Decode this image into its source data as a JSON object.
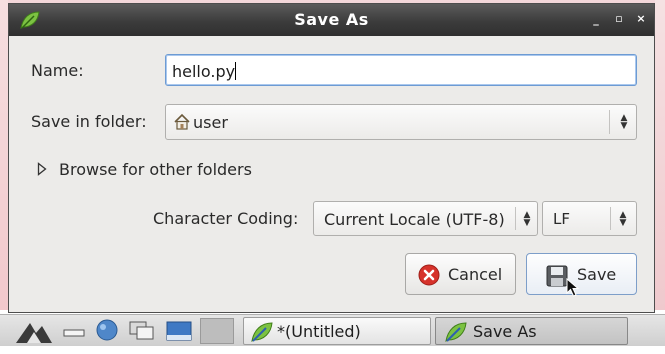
{
  "window": {
    "title": "Save As",
    "controls": {
      "minimize": "_",
      "maximize": "▫",
      "close": "×"
    }
  },
  "form": {
    "name_label": "Name:",
    "name_value": "hello.py",
    "folder_label": "Save in folder:",
    "folder_value": "user",
    "folder_icon": "home-icon",
    "browse_label": "Browse for other folders",
    "coding_label": "Character Coding:",
    "coding_value": "Current Locale (UTF-8)",
    "line_ending_value": "LF"
  },
  "buttons": {
    "cancel_label": "Cancel",
    "save_label": "Save"
  },
  "taskbar": {
    "launchers": [
      "menu-logo-icon",
      "minimize-all-icon",
      "network-icon",
      "window-switch-icon",
      "desktop-icon"
    ],
    "tasks": [
      {
        "label": "*(Untitled)",
        "icon": "leafpad-icon",
        "active": false
      },
      {
        "label": "Save As",
        "icon": "leafpad-icon",
        "active": true
      }
    ]
  },
  "colors": {
    "titlebar": "#3c3c3c",
    "focus_border": "#6d9bd3",
    "cancel_icon": "#d6322b"
  }
}
